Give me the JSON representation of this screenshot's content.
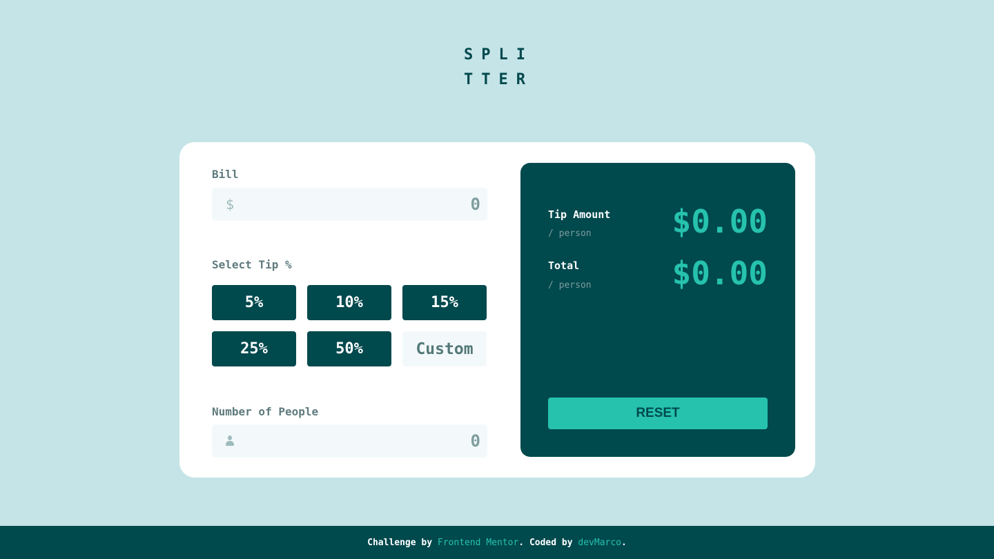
{
  "logo": {
    "line1": "SPLI",
    "line2": "TTER"
  },
  "bill": {
    "label": "Bill",
    "currency_symbol": "$",
    "value": "0"
  },
  "tip": {
    "label": "Select Tip %",
    "options": [
      "5%",
      "10%",
      "15%",
      "25%",
      "50%"
    ],
    "custom_label": "Custom"
  },
  "people": {
    "label": "Number of People",
    "value": "0",
    "icon": "person-icon"
  },
  "result": {
    "tip_label": "Tip Amount",
    "tip_sub": "/ person",
    "tip_value": "$0.00",
    "total_label": "Total",
    "total_sub": "/ person",
    "total_value": "$0.00",
    "reset_label": "RESET"
  },
  "footer": {
    "prefix": "Challenge by ",
    "link1": "Frontend Mentor",
    "middle": ". Coded by ",
    "link2": "devMarco",
    "suffix": "."
  },
  "colors": {
    "background": "#c5e4e7",
    "dark_cyan": "#00494d",
    "strong_cyan": "#26c2ad",
    "light_grayish_cyan": "#f3f9fa"
  }
}
